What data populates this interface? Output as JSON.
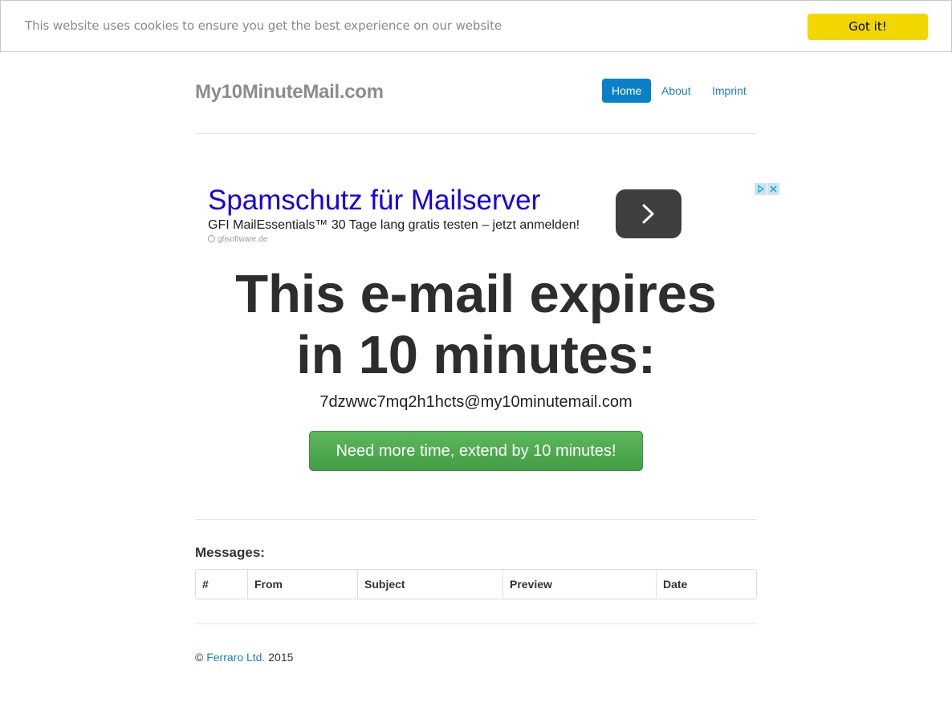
{
  "cookie_bar": {
    "message": "This website uses cookies to ensure you get the best experience on our website",
    "button_label": "Got it!"
  },
  "header": {
    "brand": "My10MinuteMail.com",
    "nav": [
      {
        "label": "Home",
        "active": true
      },
      {
        "label": "About",
        "active": false
      },
      {
        "label": "Imprint",
        "active": false
      }
    ]
  },
  "ad": {
    "title": "Spamschutz für Mailserver",
    "description": "GFI MailEssentials™ 30 Tage lang gratis testen – jetzt anmelden!",
    "domain": "gfisoftware.de"
  },
  "main": {
    "headline_line1": "This e-mail expires",
    "headline_line2": "in 10 minutes:",
    "email_address": "7dzwwc7mq2h1hcts@my10minutemail.com",
    "extend_button": "Need more time, extend by 10 minutes!"
  },
  "messages": {
    "title": "Messages:",
    "columns": [
      "#",
      "From",
      "Subject",
      "Preview",
      "Date"
    ],
    "rows": []
  },
  "footer": {
    "copyright_symbol": "©",
    "company_link": "Ferraro Ltd.",
    "year": "2015"
  },
  "colors": {
    "cookie_button": "#f1d600",
    "nav_active": "#0a80c9",
    "link": "#1a7fc1",
    "extend_button": "#5cb85c",
    "ad_title": "#1300e8"
  }
}
